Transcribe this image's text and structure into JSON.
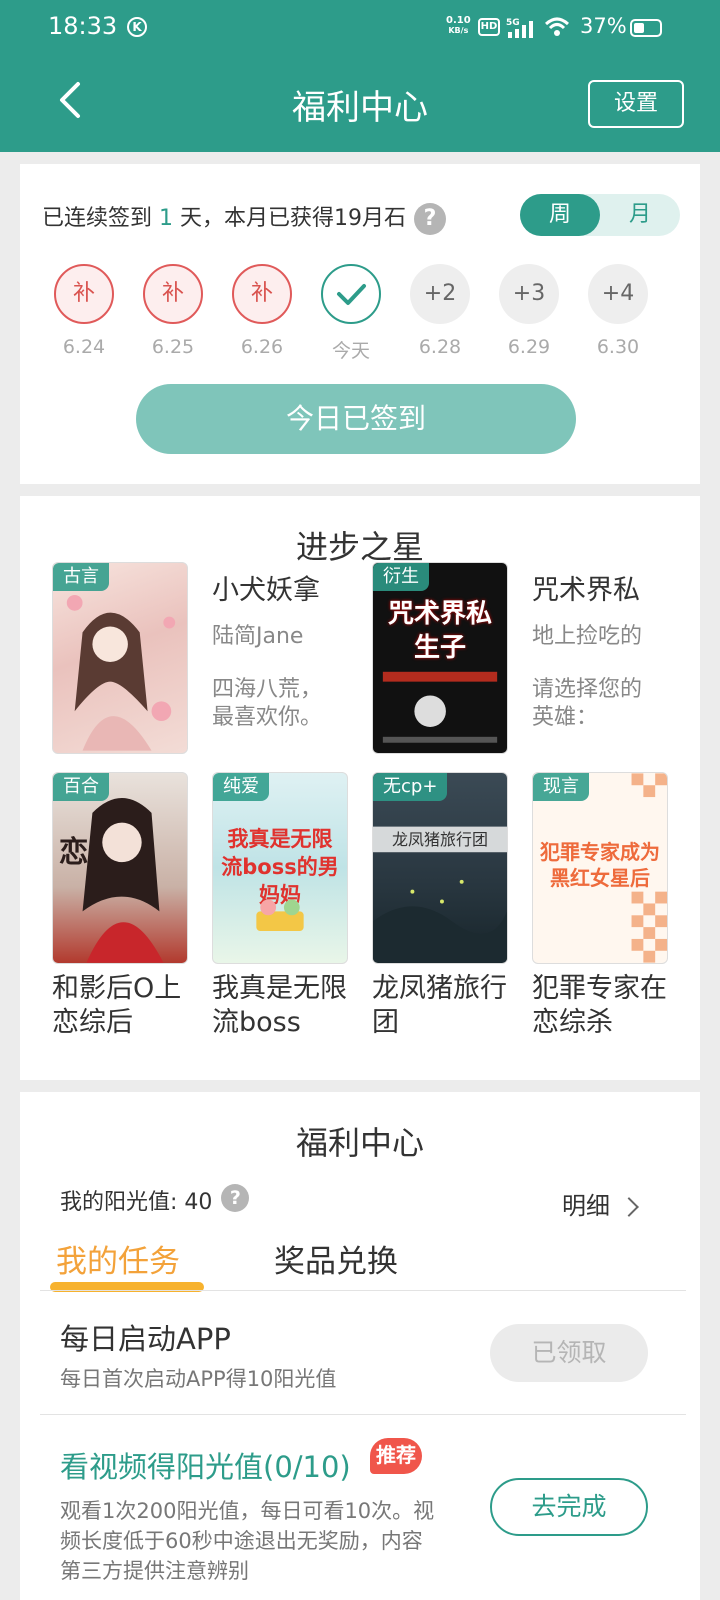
{
  "status": {
    "time": "18:33",
    "net_speed_top": "0.10",
    "net_speed_bottom": "KB/s",
    "hd": "HD",
    "network": "5G",
    "battery": "37%"
  },
  "header": {
    "title": "福利中心",
    "settings_label": "设置"
  },
  "signin": {
    "streak_prefix": "已连续签到",
    "streak_days": "1",
    "streak_suffix": "天，本月已获得19月石",
    "toggle_week": "周",
    "toggle_month": "月",
    "days": [
      {
        "label": "补",
        "date": "6.24"
      },
      {
        "label": "补",
        "date": "6.25"
      },
      {
        "label": "补",
        "date": "6.26"
      },
      {
        "label": "",
        "date": "今天"
      },
      {
        "label": "+2",
        "date": "6.28"
      },
      {
        "label": "+3",
        "date": "6.29"
      },
      {
        "label": "+4",
        "date": "6.30"
      }
    ],
    "button_label": "今日已签到"
  },
  "stars": {
    "title": "进步之星",
    "featured": [
      {
        "tag": "古言",
        "title": "小犬妖拿",
        "author": "陆简Jane",
        "desc": "四海八荒，最喜欢你。"
      },
      {
        "tag": "衍生",
        "title": "咒术界私",
        "author": "地上捡吃的",
        "desc": "请选择您的英雄：",
        "cover_text": "咒术界私生子"
      }
    ],
    "books": [
      {
        "tag": "百合",
        "title": "和影后O上恋综后"
      },
      {
        "tag": "纯爱",
        "title": "我真是无限流boss",
        "cover_text": "我真是无限流boss的男妈妈"
      },
      {
        "tag": "无cp+",
        "title": "龙凤猪旅行团",
        "cover_text": "龙凤猪旅行团"
      },
      {
        "tag": "现言",
        "title": "犯罪专家在恋综杀",
        "cover_text": "犯罪专家成为黑红女星后"
      }
    ]
  },
  "welfare": {
    "title": "福利中心",
    "sunshine_label": "我的阳光值:",
    "sunshine_value": "40",
    "detail_label": "明细",
    "tab_tasks": "我的任务",
    "tab_prizes": "奖品兑换",
    "tasks": [
      {
        "name": "每日启动APP",
        "desc": "每日首次启动APP得10阳光值",
        "button": "已领取"
      },
      {
        "name": "看视频得阳光值(0/10)",
        "badge": "推荐",
        "desc": "观看1次200阳光值，每日可看10次。视频长度低于60秒中途退出无奖励，内容第三方提供注意辨别",
        "button": "去完成"
      }
    ]
  },
  "colors": {
    "primary": "#2d9c8a",
    "accent_orange": "#f7b22e",
    "makeup_red": "#d9534f",
    "badge_red": "#f0564b"
  }
}
